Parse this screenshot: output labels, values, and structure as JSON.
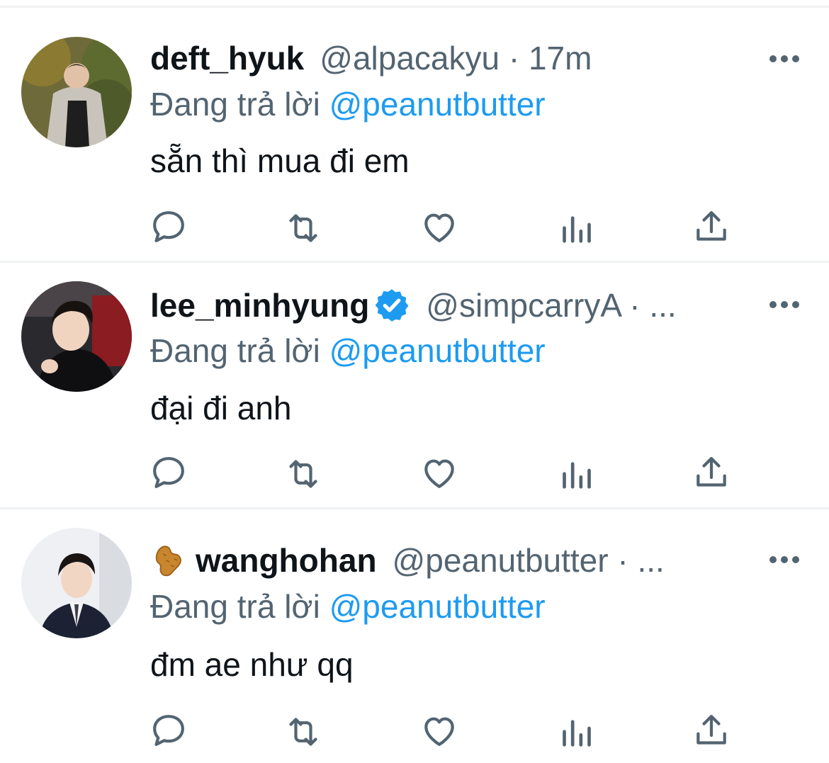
{
  "tweets": [
    {
      "display_name": "deft_hyuk",
      "handle_meta": "@alpacakyu · 17m",
      "reply_prefix": "Đang trả lời",
      "reply_mention": "@peanutbutter",
      "text": "sẵn thì mua đi em",
      "verified": false,
      "name_emoji": null
    },
    {
      "display_name": "lee_minhyung",
      "handle_meta": "@simpcarryA · ...",
      "reply_prefix": "Đang trả lời",
      "reply_mention": "@peanutbutter",
      "text": "đại đi anh",
      "verified": true,
      "name_emoji": null
    },
    {
      "display_name": "wanghohan",
      "handle_meta": "@peanutbutter · ...",
      "reply_prefix": "Đang trả lời",
      "reply_mention": "@peanutbutter",
      "text": "đm ae như qq",
      "verified": false,
      "name_emoji": "peanut-emoji"
    }
  ],
  "icons": {
    "reply": "reply-icon",
    "retweet": "retweet-icon",
    "like": "like-icon",
    "analytics": "analytics-icon",
    "share": "share-icon",
    "more": "more-icon",
    "verified": "verified-badge-icon"
  },
  "colors": {
    "text": "#0f1419",
    "secondary": "#536471",
    "accent": "#1d9bf0",
    "divider": "#eff1f3"
  }
}
